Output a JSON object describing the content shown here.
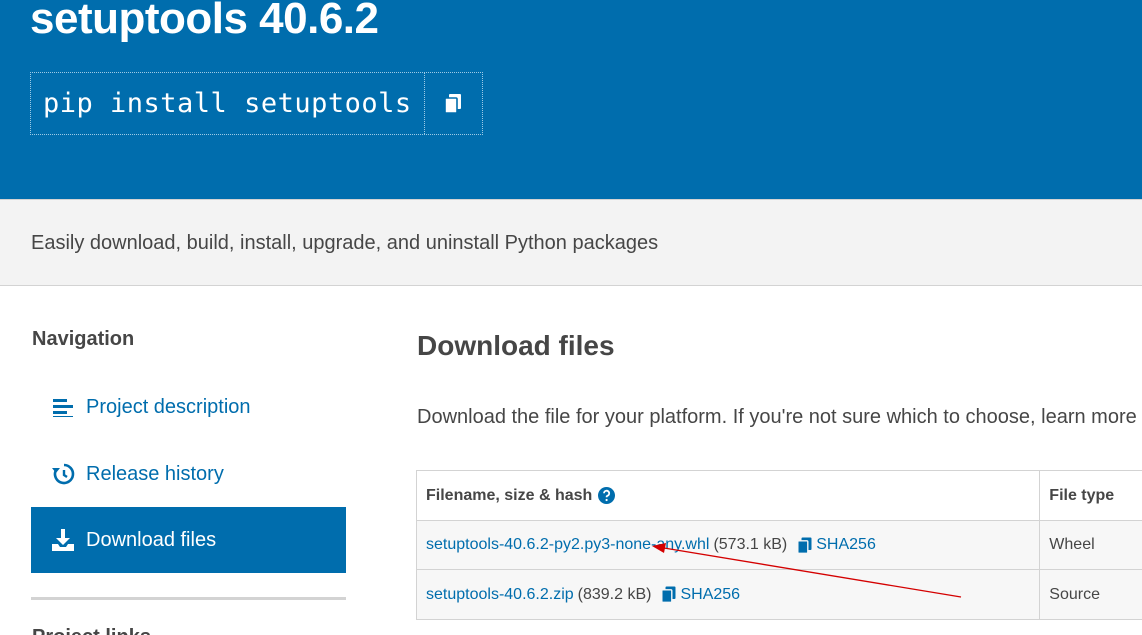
{
  "header": {
    "package_title": "setuptools 40.6.2",
    "install_command": "pip install setuptools"
  },
  "summary": "Easily download, build, install, upgrade, and uninstall Python packages",
  "navigation": {
    "title": "Navigation",
    "items": [
      {
        "label": "Project description",
        "icon": "list-icon"
      },
      {
        "label": "Release history",
        "icon": "history-icon"
      },
      {
        "label": "Download files",
        "icon": "download-icon",
        "active": true
      }
    ],
    "next_section_partial": "Project links"
  },
  "downloads": {
    "heading": "Download files",
    "intro": "Download the file for your platform. If you're not sure which to choose, learn more",
    "columns": [
      "Filename, size & hash",
      "File type"
    ],
    "files": [
      {
        "filename": "setuptools-40.6.2-py2.py3-none-any.whl",
        "size": "(573.1 kB)",
        "hash": "SHA256",
        "type": "Wheel"
      },
      {
        "filename": "setuptools-40.6.2.zip",
        "size": "(839.2 kB)",
        "hash": "SHA256",
        "type": "Source"
      }
    ]
  },
  "colors": {
    "brand_blue": "#006dad",
    "annotation_arrow": "#d40000"
  }
}
